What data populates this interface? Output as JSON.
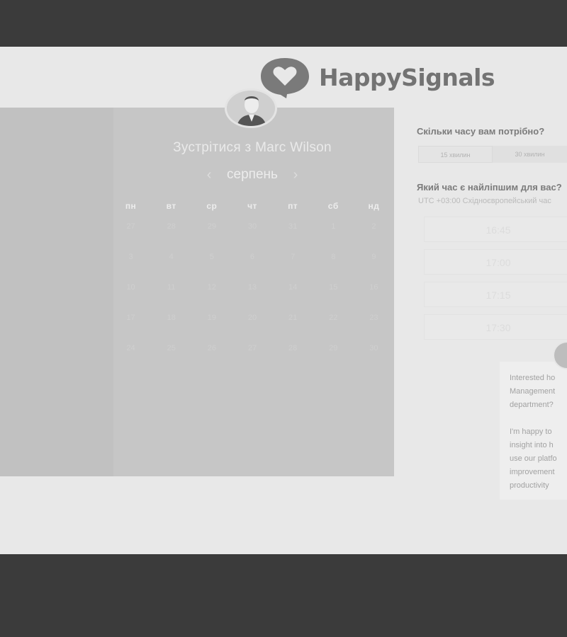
{
  "brand": {
    "name": "HappySignals"
  },
  "scheduler": {
    "title": "Зустрітися з Marc Wilson",
    "month": "серпень",
    "prev_icon": "chevron-left-icon",
    "next_icon": "chevron-right-icon",
    "weekdays": [
      "пн",
      "вт",
      "ср",
      "чт",
      "пт",
      "сб",
      "нд"
    ],
    "weeks": [
      [
        "27",
        "28",
        "29",
        "30",
        "31",
        "1",
        "2"
      ],
      [
        "3",
        "4",
        "5",
        "6",
        "7",
        "8",
        "9"
      ],
      [
        "10",
        "11",
        "12",
        "13",
        "14",
        "15",
        "16"
      ],
      [
        "17",
        "18",
        "19",
        "20",
        "21",
        "22",
        "23"
      ],
      [
        "24",
        "25",
        "26",
        "27",
        "28",
        "29",
        "30"
      ]
    ]
  },
  "booking": {
    "duration_question": "Скільки часу вам потрібно?",
    "durations": [
      "15 хвилин",
      "30 хвилин"
    ],
    "time_question": "Який час є найліпшим для вас?",
    "timezone": "UTC +03:00 Східноєвропейський час",
    "slots": [
      "16:45",
      "17:00",
      "17:15",
      "17:30"
    ]
  },
  "chat": {
    "message_1_lines": [
      "Interested ho",
      "Management",
      "department?"
    ],
    "message_2_lines": [
      "I'm happy to",
      "insight into h",
      "use our platfo",
      "improvement",
      "productivity"
    ]
  },
  "colors": {
    "backdrop": "#3b3b3b",
    "page": "#e8e8e8",
    "calendar_panel": "#c6c6c6"
  }
}
